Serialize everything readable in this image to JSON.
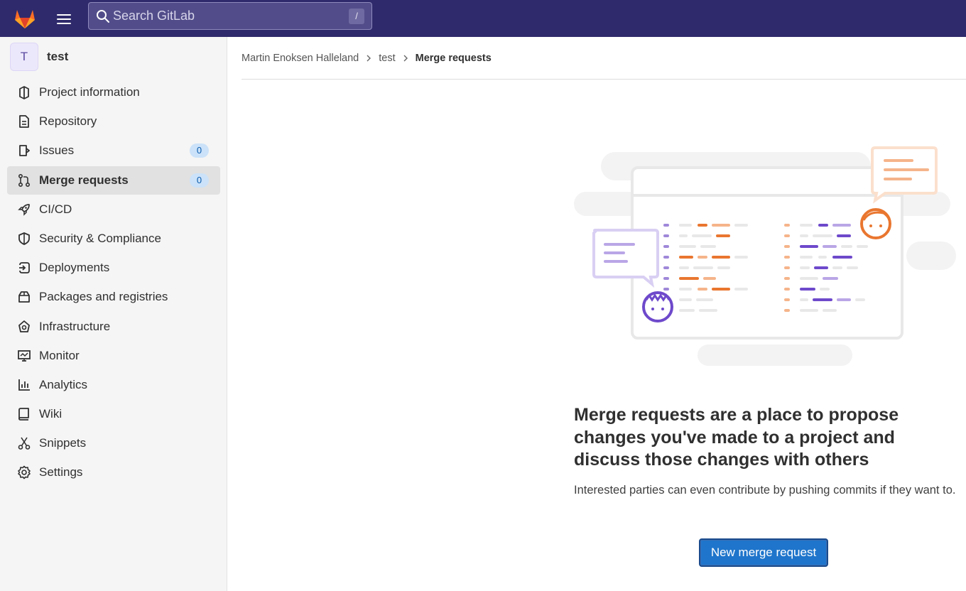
{
  "topbar": {
    "search_placeholder": "Search GitLab",
    "search_shortcut": "/"
  },
  "project": {
    "avatar_letter": "T",
    "name": "test"
  },
  "sidebar": {
    "items": [
      {
        "label": "Project information",
        "icon": "project-icon"
      },
      {
        "label": "Repository",
        "icon": "document-icon"
      },
      {
        "label": "Issues",
        "icon": "issues-icon",
        "badge": "0"
      },
      {
        "label": "Merge requests",
        "icon": "merge-request-icon",
        "badge": "0",
        "active": true
      },
      {
        "label": "CI/CD",
        "icon": "rocket-icon"
      },
      {
        "label": "Security & Compliance",
        "icon": "shield-icon"
      },
      {
        "label": "Deployments",
        "icon": "deployments-icon"
      },
      {
        "label": "Packages and registries",
        "icon": "package-icon"
      },
      {
        "label": "Infrastructure",
        "icon": "cloud-gear-icon"
      },
      {
        "label": "Monitor",
        "icon": "monitor-icon"
      },
      {
        "label": "Analytics",
        "icon": "chart-icon"
      },
      {
        "label": "Wiki",
        "icon": "book-icon"
      },
      {
        "label": "Snippets",
        "icon": "scissors-icon"
      },
      {
        "label": "Settings",
        "icon": "settings-icon"
      }
    ]
  },
  "breadcrumb": [
    "Martin Enoksen Halleland",
    "test",
    "Merge requests"
  ],
  "empty_state": {
    "title": "Merge requests are a place to propose changes you've made to a project and discuss those changes with others",
    "description": "Interested parties can even contribute by pushing commits if they want to.",
    "button_label": "New merge request"
  },
  "colors": {
    "topbar": "#2f2a6b",
    "accent_orange": "#e9762f",
    "accent_purple": "#6e49cb",
    "button_blue": "#1f75cb"
  }
}
